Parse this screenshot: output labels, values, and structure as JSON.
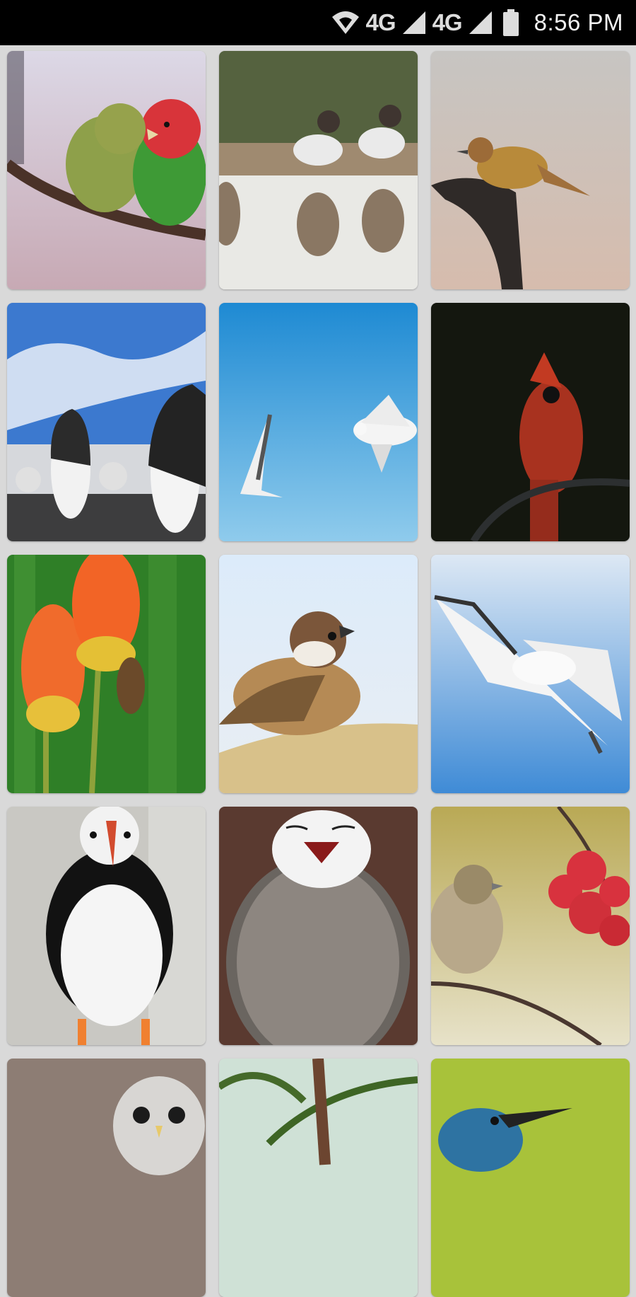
{
  "status_bar": {
    "network_1": "4G",
    "network_2": "4G",
    "time": "8:56 PM",
    "icons": [
      "wifi-icon",
      "signal-icon",
      "battery-icon"
    ]
  },
  "gallery": {
    "tiles": [
      {
        "subject": "lovebirds"
      },
      {
        "subject": "finches-on-log"
      },
      {
        "subject": "wren"
      },
      {
        "subject": "penguins"
      },
      {
        "subject": "seagulls-sky"
      },
      {
        "subject": "cardinal"
      },
      {
        "subject": "bird-on-flower"
      },
      {
        "subject": "sparrow"
      },
      {
        "subject": "seagulls-flight"
      },
      {
        "subject": "puffin"
      },
      {
        "subject": "snowy-owl"
      },
      {
        "subject": "finch-berries"
      },
      {
        "subject": "barred-owl"
      },
      {
        "subject": "palm-bird"
      },
      {
        "subject": "kingfisher"
      }
    ]
  }
}
